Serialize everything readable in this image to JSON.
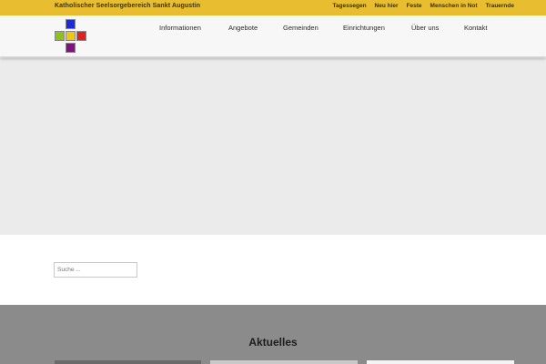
{
  "topbar": {
    "org_name": "Katholischer Seelsorgebereich Sankt Augustin",
    "links": [
      "Tagessegen",
      "Neu hier",
      "Feste",
      "Menschen in Not",
      "Trauernde"
    ]
  },
  "colors": {
    "topbar": "#e8bd2f",
    "logo_top": "#1d2bd6",
    "logo_left": "#8cc21a",
    "logo_center": "#f1c60e",
    "logo_right": "#e12020",
    "logo_bottom": "#7b167a"
  },
  "nav": {
    "items": [
      "Informationen",
      "Angebote",
      "Gemeinden",
      "Einrichtungen",
      "Über uns",
      "Kontakt"
    ]
  },
  "search": {
    "placeholder": "Suche ..."
  },
  "news": {
    "heading": "Aktuelles"
  }
}
